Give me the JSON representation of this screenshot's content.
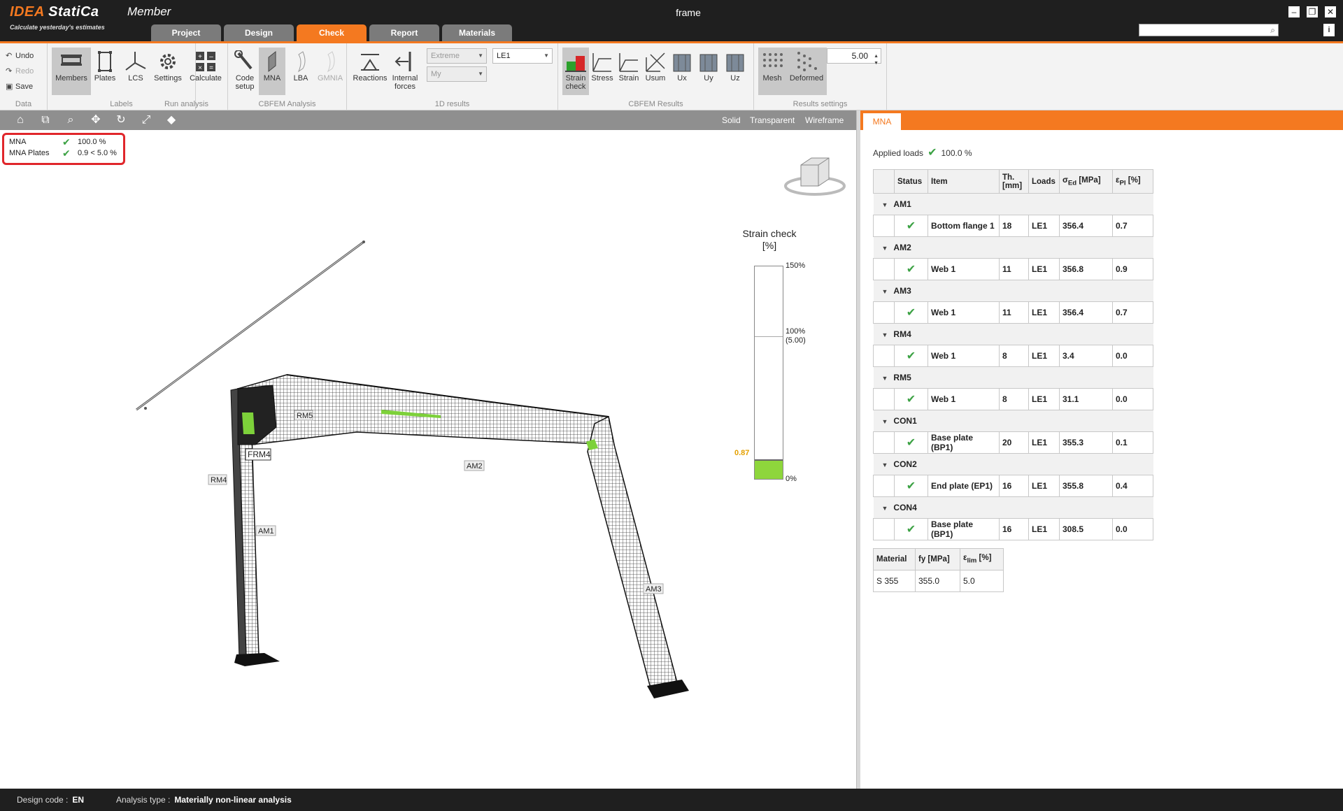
{
  "app": {
    "logo": "IDEA StatiCa",
    "product": "Member",
    "slogan": "Calculate yesterday's estimates",
    "document_title": "frame",
    "window_buttons": [
      "minimize",
      "maximize",
      "close"
    ]
  },
  "tabs": [
    {
      "label": "Project",
      "active": false
    },
    {
      "label": "Design",
      "active": false
    },
    {
      "label": "Check",
      "active": true
    },
    {
      "label": "Report",
      "active": false
    },
    {
      "label": "Materials",
      "active": false
    }
  ],
  "ribbon": {
    "data": {
      "undo": "Undo",
      "redo": "Redo",
      "save": "Save",
      "group": "Data"
    },
    "labels": {
      "members": "Members",
      "plates": "Plates",
      "lcs": "LCS",
      "group": "Labels"
    },
    "run": {
      "settings": "Settings",
      "calculate": "Calculate",
      "group": "Run analysis"
    },
    "cbfem": {
      "code_setup_1": "Code",
      "code_setup_2": "setup",
      "mna": "MNA",
      "lba": "LBA",
      "gmnia": "GMNIA",
      "group": "CBFEM Analysis"
    },
    "results1d": {
      "reactions": "Reactions",
      "internal_1": "Internal",
      "internal_2": "forces",
      "combo_extreme": "Extreme",
      "combo_my": "My",
      "combo_le": "LE1",
      "group": "1D results"
    },
    "cbfem_results": {
      "strain_check_1": "Strain",
      "strain_check_2": "check",
      "stress": "Stress",
      "strain": "Strain",
      "usum": "Usum",
      "ux": "Ux",
      "uy": "Uy",
      "uz": "Uz",
      "group": "CBFEM Results"
    },
    "results_settings": {
      "mesh": "Mesh",
      "deformed": "Deformed",
      "scale_value": "5.00",
      "group": "Results settings"
    }
  },
  "view_modes": [
    "Solid",
    "Transparent",
    "Wireframe"
  ],
  "summary": [
    {
      "name": "MNA",
      "value": "100.0 %"
    },
    {
      "name": "MNA Plates",
      "value": "0.9 < 5.0 %"
    }
  ],
  "model_labels": {
    "rm5": "RM5",
    "rm4_top": "FRM4",
    "rm4": "RM4",
    "am1": "AM1",
    "am2": "AM2",
    "am3": "AM3"
  },
  "strain_scale": {
    "title_1": "Strain check",
    "title_2": "[%]",
    "max_label": "150%",
    "mid_label_1": "100%",
    "mid_label_2": "(5.00)",
    "min_label": "0%",
    "current_value": "0.87",
    "current_fraction": 0.0058,
    "fill_color": "#8ed63c"
  },
  "right_panel": {
    "tab": "MNA",
    "applied_loads_label": "Applied loads",
    "applied_loads_value": "100.0 %",
    "columns": {
      "status": "Status",
      "item": "Item",
      "th_1": "Th.",
      "th_2": "[mm]",
      "loads": "Loads",
      "sigma": "σ",
      "sigma_sub": "Ed",
      "sigma_unit": "[MPa]",
      "eps": "ε",
      "eps_sub": "Pl",
      "eps_unit": "[%]"
    },
    "groups": [
      {
        "name": "AM1",
        "rows": [
          {
            "item": "Bottom flange 1",
            "th": "18",
            "loads": "LE1",
            "sigma": "356.4",
            "eps": "0.7"
          }
        ]
      },
      {
        "name": "AM2",
        "rows": [
          {
            "item": "Web 1",
            "th": "11",
            "loads": "LE1",
            "sigma": "356.8",
            "eps": "0.9"
          }
        ]
      },
      {
        "name": "AM3",
        "rows": [
          {
            "item": "Web 1",
            "th": "11",
            "loads": "LE1",
            "sigma": "356.4",
            "eps": "0.7"
          }
        ]
      },
      {
        "name": "RM4",
        "rows": [
          {
            "item": "Web 1",
            "th": "8",
            "loads": "LE1",
            "sigma": "3.4",
            "eps": "0.0"
          }
        ]
      },
      {
        "name": "RM5",
        "rows": [
          {
            "item": "Web 1",
            "th": "8",
            "loads": "LE1",
            "sigma": "31.1",
            "eps": "0.0"
          }
        ]
      },
      {
        "name": "CON1",
        "rows": [
          {
            "item": "Base plate (BP1)",
            "th": "20",
            "loads": "LE1",
            "sigma": "355.3",
            "eps": "0.1"
          }
        ]
      },
      {
        "name": "CON2",
        "rows": [
          {
            "item": "End plate (EP1)",
            "th": "16",
            "loads": "LE1",
            "sigma": "355.8",
            "eps": "0.4"
          }
        ]
      },
      {
        "name": "CON4",
        "rows": [
          {
            "item": "Base plate (BP1)",
            "th": "16",
            "loads": "LE1",
            "sigma": "308.5",
            "eps": "0.0"
          }
        ]
      }
    ],
    "material": {
      "headers": {
        "material": "Material",
        "fy": "fy [MPa]",
        "eps": "ε",
        "eps_sub": "lim",
        "eps_unit": "[%]"
      },
      "row": {
        "material": "S 355",
        "fy": "355.0",
        "eps": "5.0"
      }
    }
  },
  "status_bar": {
    "design_code_label": "Design code :",
    "design_code": "EN",
    "analysis_type_label": "Analysis type :",
    "analysis_type": "Materially non-linear analysis"
  },
  "colors": {
    "accent": "#f47920",
    "ok": "#3ca244",
    "highlight": "#e0262b"
  }
}
